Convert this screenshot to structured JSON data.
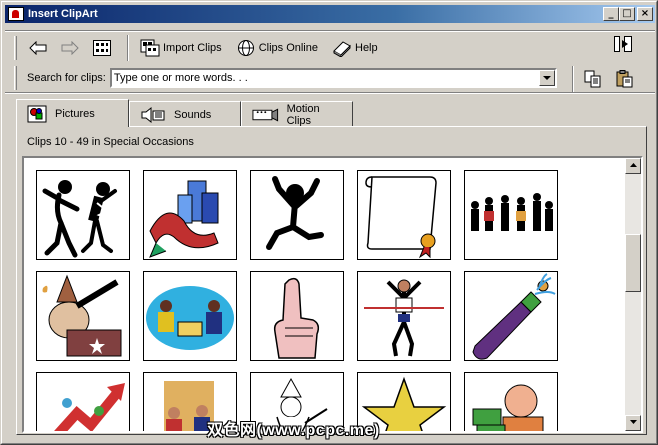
{
  "window": {
    "title": "Insert ClipArt"
  },
  "title_buttons": {
    "minimize": "_",
    "maximize": "□",
    "close": "×"
  },
  "toolbar": {
    "import_label": "Import Clips",
    "online_label": "Clips Online",
    "help_label": "Help"
  },
  "search": {
    "label": "Search for clips:",
    "value": "Type one or more words. . ."
  },
  "tabs": [
    {
      "label": "Pictures",
      "icon": "pictures-icon"
    },
    {
      "label": "Sounds",
      "icon": "sounds-icon"
    },
    {
      "label": "Motion Clips",
      "icon": "motion-clips-icon"
    }
  ],
  "gallery": {
    "breadcrumb": "Clips 10 - 49 in Special Occasions",
    "clips": [
      "dancing-couple-clip",
      "buildings-ribbon-clip",
      "jumping-man-clip",
      "diploma-scroll-clip",
      "group-cheer-clip",
      "wizard-telescope-clip",
      "meeting-table-clip",
      "pointing-finger-clip",
      "runner-finish-clip",
      "champagne-bottle-clip",
      "rising-arrow-clip",
      "award-ceremony-clip",
      "wizard-sketch-clip",
      "gold-star-clip",
      "money-man-clip"
    ]
  },
  "watermark": "双色网(www.pcpc.me)",
  "colors": {
    "titlebar_start": "#0a246a",
    "titlebar_end": "#a6caf0",
    "face": "#d4d0c8"
  }
}
